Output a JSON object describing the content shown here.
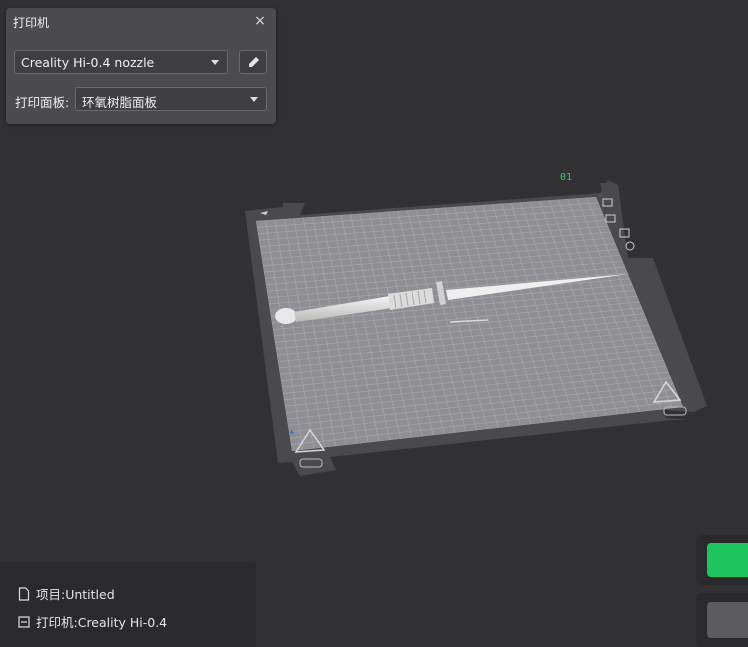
{
  "printer_panel": {
    "title": "打印机",
    "close_glyph": "×",
    "printer_select": {
      "value": "Creality Hi-0.4 nozzle"
    },
    "plate_label": "打印面板:",
    "plate_select": {
      "value": "环氧树脂面板"
    }
  },
  "viewport": {
    "plate_number": "01",
    "model": "dagger"
  },
  "info_panel": {
    "project": "项目:Untitled",
    "printer": "打印机:Creality Hi-0.4"
  },
  "actions": {
    "slice_color": "#1ec55f",
    "export_color": "#5c5c60"
  },
  "icons": [
    "close-icon",
    "chevron-down-icon",
    "pencil-icon",
    "file-icon",
    "printer-icon"
  ]
}
